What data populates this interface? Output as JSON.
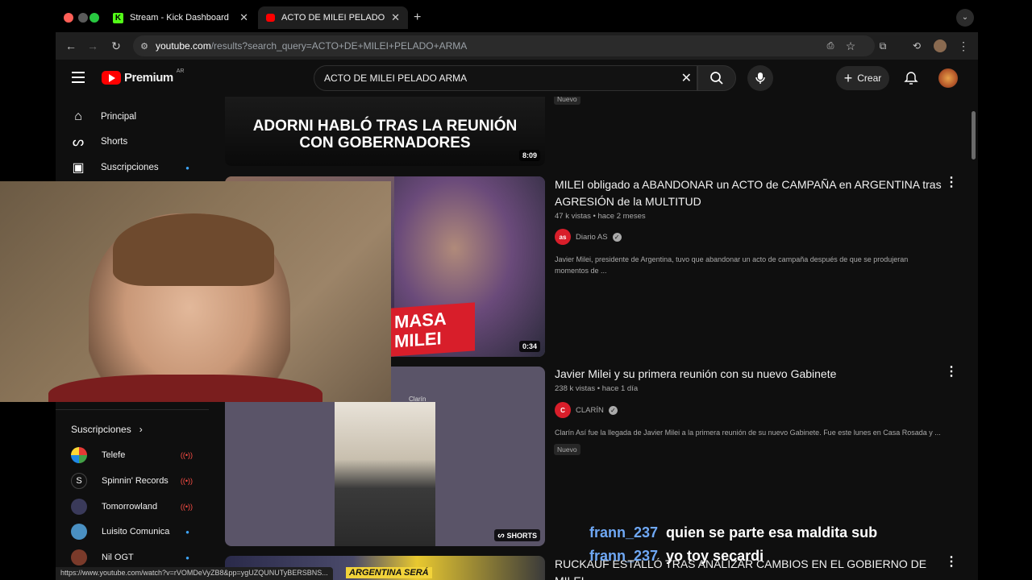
{
  "browser": {
    "tabs": [
      {
        "title": "Stream - Kick Dashboard",
        "active": false
      },
      {
        "title": "ACTO DE MILEI PELADO ARMA",
        "active": true
      }
    ],
    "url_domain": "youtube.com",
    "url_path": "/results?search_query=ACTO+DE+MILEI+PELADO+ARMA",
    "status_url": "https://www.youtube.com/watch?v=rVOMDeVyZB8&pp=ygUZQUNUTyBERSBNS..."
  },
  "masthead": {
    "logo_text": "Premium",
    "country": "AR",
    "search_value": "ACTO DE MILEI PELADO ARMA",
    "create_label": "Crear"
  },
  "sidebar": {
    "items": [
      {
        "label": "Principal",
        "icon": "home-icon"
      },
      {
        "label": "Shorts",
        "icon": "shorts-icon"
      },
      {
        "label": "Suscripciones",
        "icon": "subscriptions-icon"
      }
    ],
    "subs_heading": "Suscripciones",
    "subs": [
      {
        "name": "Telefe",
        "status": "live",
        "color": "#ffffff"
      },
      {
        "name": "Spinnin' Records",
        "status": "live",
        "color": "#111111"
      },
      {
        "name": "Tomorrowland",
        "status": "live",
        "color": "#3a3a5a"
      },
      {
        "name": "Luisito Comunica",
        "status": "new",
        "color": "#4a90c2"
      },
      {
        "name": "Nil OGT",
        "status": "new",
        "color": "#7a3a2a"
      }
    ]
  },
  "results": {
    "top": {
      "thumb_text": "ADORNI HABLÓ TRAS LA REUNIÓN CON GOBERNADORES",
      "duration": "8:09",
      "badge": "Nuevo"
    },
    "video1": {
      "title": "MILEI obligado a ABANDONAR un ACTO de CAMPAÑA en ARGENTINA tras AGRESIÓN de la MULTITUD",
      "meta": "47 k vistas • hace 2 meses",
      "channel": "Diario AS",
      "channel_avatar": "as",
      "description": "Javier Milei, presidente de Argentina, tuvo que abandonar un acto de campaña después de que se produjeran momentos de ...",
      "duration": "0:34",
      "thumb_text1": "MASA",
      "thumb_text2": "MILEI"
    },
    "video2": {
      "title": "Javier Milei y su primera reunión con su nuevo Gabinete",
      "meta": "238 k vistas • hace 1 día",
      "channel": "CLARÍN",
      "channel_avatar": "C",
      "description": "Clarín Así fue la llegada de Javier Milei a la primera reunión de su nuevo Gabinete. Fue este lunes en Casa Rosada y ...",
      "badge": "Nuevo",
      "shorts_label": "SHORTS",
      "watermark": "Clarín"
    },
    "video3": {
      "title": "RUCKAUF ESTALLÓ TRAS ANALIZAR CAMBIOS EN EL GOBIERNO DE MILEI",
      "thumb_text": "ARGENTINA SERÁ"
    }
  },
  "chat": [
    {
      "user": "frann_237",
      "message": "quien se parte esa maldita sub"
    },
    {
      "user": "frann_237",
      "message": "yo toy secardi"
    }
  ],
  "colors": {
    "yt_red": "#ff0000",
    "chat_user": "#6fa8f5",
    "live": "#ff4e45",
    "new_dot": "#3ea6ff"
  }
}
